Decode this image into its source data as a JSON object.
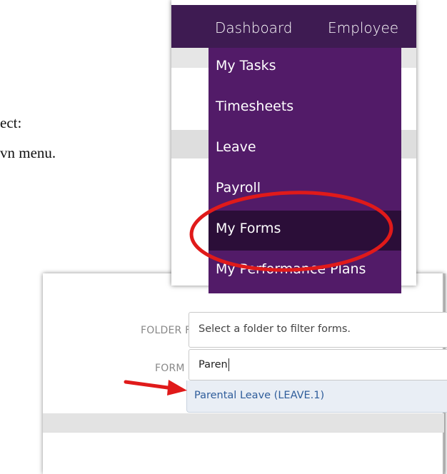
{
  "document": {
    "line1": "ect:",
    "line2": "vn menu."
  },
  "nav": {
    "items": [
      "Dashboard",
      "Employee"
    ],
    "dropdown": [
      "My Tasks",
      "Timesheets",
      "Leave",
      "Payroll",
      "My Forms",
      "My Performance Plans"
    ],
    "selected": "My Forms"
  },
  "form": {
    "folder_filter_label": "FOLDER FILTER",
    "folder_filter_placeholder": "Select a folder to filter forms.",
    "form_label": "FORM",
    "form_value": "Paren",
    "suggestion": "Parental Leave (LEAVE.1)"
  },
  "colors": {
    "nav_bar": "#3e1b52",
    "dropdown": "#521b68",
    "dropdown_selected": "#2b0e38",
    "annotation": "#e01a1a",
    "suggestion_text": "#2f5d9b"
  },
  "icons": {
    "arrow": "red-arrow-icon",
    "ellipse": "red-ellipse-annotation"
  }
}
